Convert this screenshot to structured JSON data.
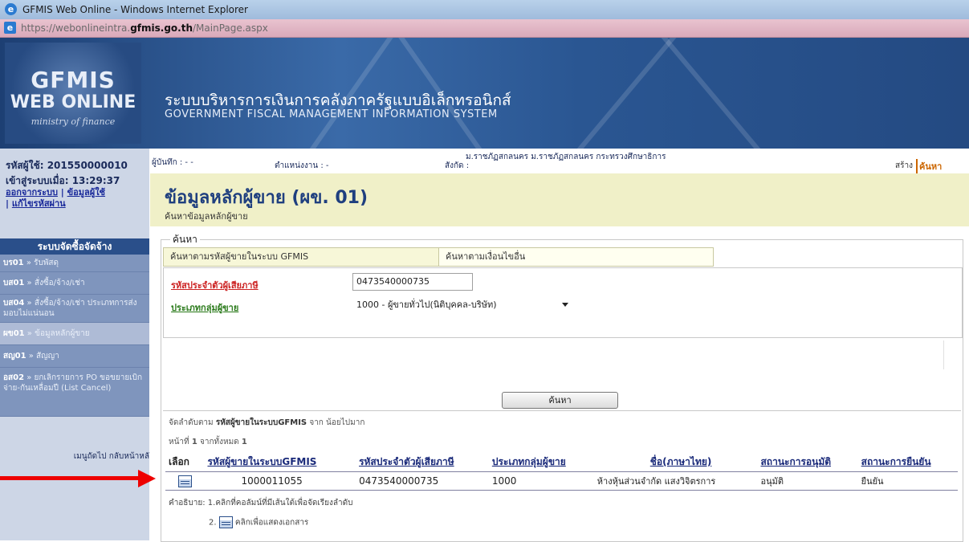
{
  "window": {
    "title": "GFMIS Web Online - Windows Internet Explorer"
  },
  "address": {
    "host_prefix": "https://webonlineintra.",
    "host": "gfmis.go.th",
    "path": "/MainPage.aspx"
  },
  "header": {
    "logo_line1": "GFMIS",
    "logo_line2": "WEB ONLINE",
    "logo_line3": "ministry of finance",
    "title_th": "ระบบบริหารการเงินการคลังภาครัฐแบบอิเล็กทรอนิกส์",
    "title_en": "GOVERNMENT FISCAL MANAGEMENT INFORMATION SYSTEM"
  },
  "sidebar": {
    "user": "รหัสผู้ใช้: 201550000010",
    "login_time": "เข้าสู่ระบบเมื่อ: 13:29:37",
    "link_logout": "ออกจากระบบ",
    "link_userinfo": "ข้อมูลผู้ใช้",
    "link_password": "แก้ไขรหัสผ่าน",
    "menu_title": "ระบบจัดซื้อจัดจ้าง",
    "items": [
      {
        "code": "บร01",
        "label": "รับพัสดุ"
      },
      {
        "code": "บส01",
        "label": "สั่งซื้อ/จ้าง/เช่า"
      },
      {
        "code": "บส04",
        "label": "สั่งซื้อ/จ้าง/เช่า ประเภทการส่งมอบไม่แน่นอน"
      },
      {
        "code": "ผข01",
        "label": "ข้อมูลหลักผู้ขาย"
      },
      {
        "code": "สญ01",
        "label": "สัญญา"
      },
      {
        "code": "อส02",
        "label": "ยกเลิกรายการ PO ขอขยายเบิกจ่าย-กันเหลื่อมปี (List Cancel)"
      }
    ],
    "footer": "เมนูถัดไป  กลับหน้าหลั"
  },
  "infobar": {
    "recorder": "ผู้บันทึก : - -",
    "position": "ตำแหน่งงาน : -",
    "affiliation_label": "สังกัด :",
    "affiliation": "ม.ราชภัฏสกลนคร ม.ราชภัฏสกลนคร กระทรวงศึกษาธิการ",
    "create": "สร้าง",
    "search": "ค้นหา"
  },
  "page": {
    "title": "ข้อมูลหลักผู้ขาย (ผข. 01)",
    "subtitle": "ค้นหาข้อมูลหลักผู้ขาย"
  },
  "search": {
    "legend": "ค้นหา",
    "tab1": "ค้นหาตามรหัสผู้ขายในระบบ GFMIS",
    "tab2": "ค้นหาตามเงื่อนไขอื่น",
    "tax_label": "รหัสประจำตัวผู้เสียภาษี",
    "tax_value": "0473540000735",
    "group_label": "ประเภทกลุ่มผู้ขาย",
    "group_value": "1000 - ผู้ขายทั่วไป(นิติบุคคล-บริษัท)",
    "button": "ค้นหา"
  },
  "results": {
    "sort_prefix": "จัดลำดับตาม",
    "sort_field": "รหัสผู้ขายในระบบGFMIS",
    "sort_suffix": "จาก น้อยไปมาก",
    "page_prefix": "หน้าที่",
    "page_num": "1",
    "page_mid": "จากทั้งหมด",
    "page_total": "1",
    "columns": [
      "เลือก",
      "รหัสผู้ขายในระบบGFMIS",
      "รหัสประจำตัวผู้เสียภาษี",
      "ประเภทกลุ่มผู้ขาย",
      "ชื่อ(ภาษาไทย)",
      "สถานะการอนุมัติ",
      "สถานะการยืนยัน"
    ],
    "row": {
      "vendor_id": "1000011055",
      "tax_id": "0473540000735",
      "group": "1000",
      "name_th": "ห้างหุ้นส่วนจำกัด แสงวิจิตรการ",
      "approval": "อนุมัติ",
      "confirm": "ยืนยัน"
    },
    "note1": "คำอธิบาย:  1.คลิกที่คอลัมน์ที่มีเส้นใต้เพื่อจัดเรียงลำดับ",
    "note2_num": "2.",
    "note2": "คลิกเพื่อแสดงเอกสาร"
  },
  "colors": {
    "header_blue": "#2a5692",
    "page_title": "#1f3f7f",
    "required_red": "#cc2222",
    "field_green": "#2a7a1a",
    "arrow": "#ee0000"
  }
}
